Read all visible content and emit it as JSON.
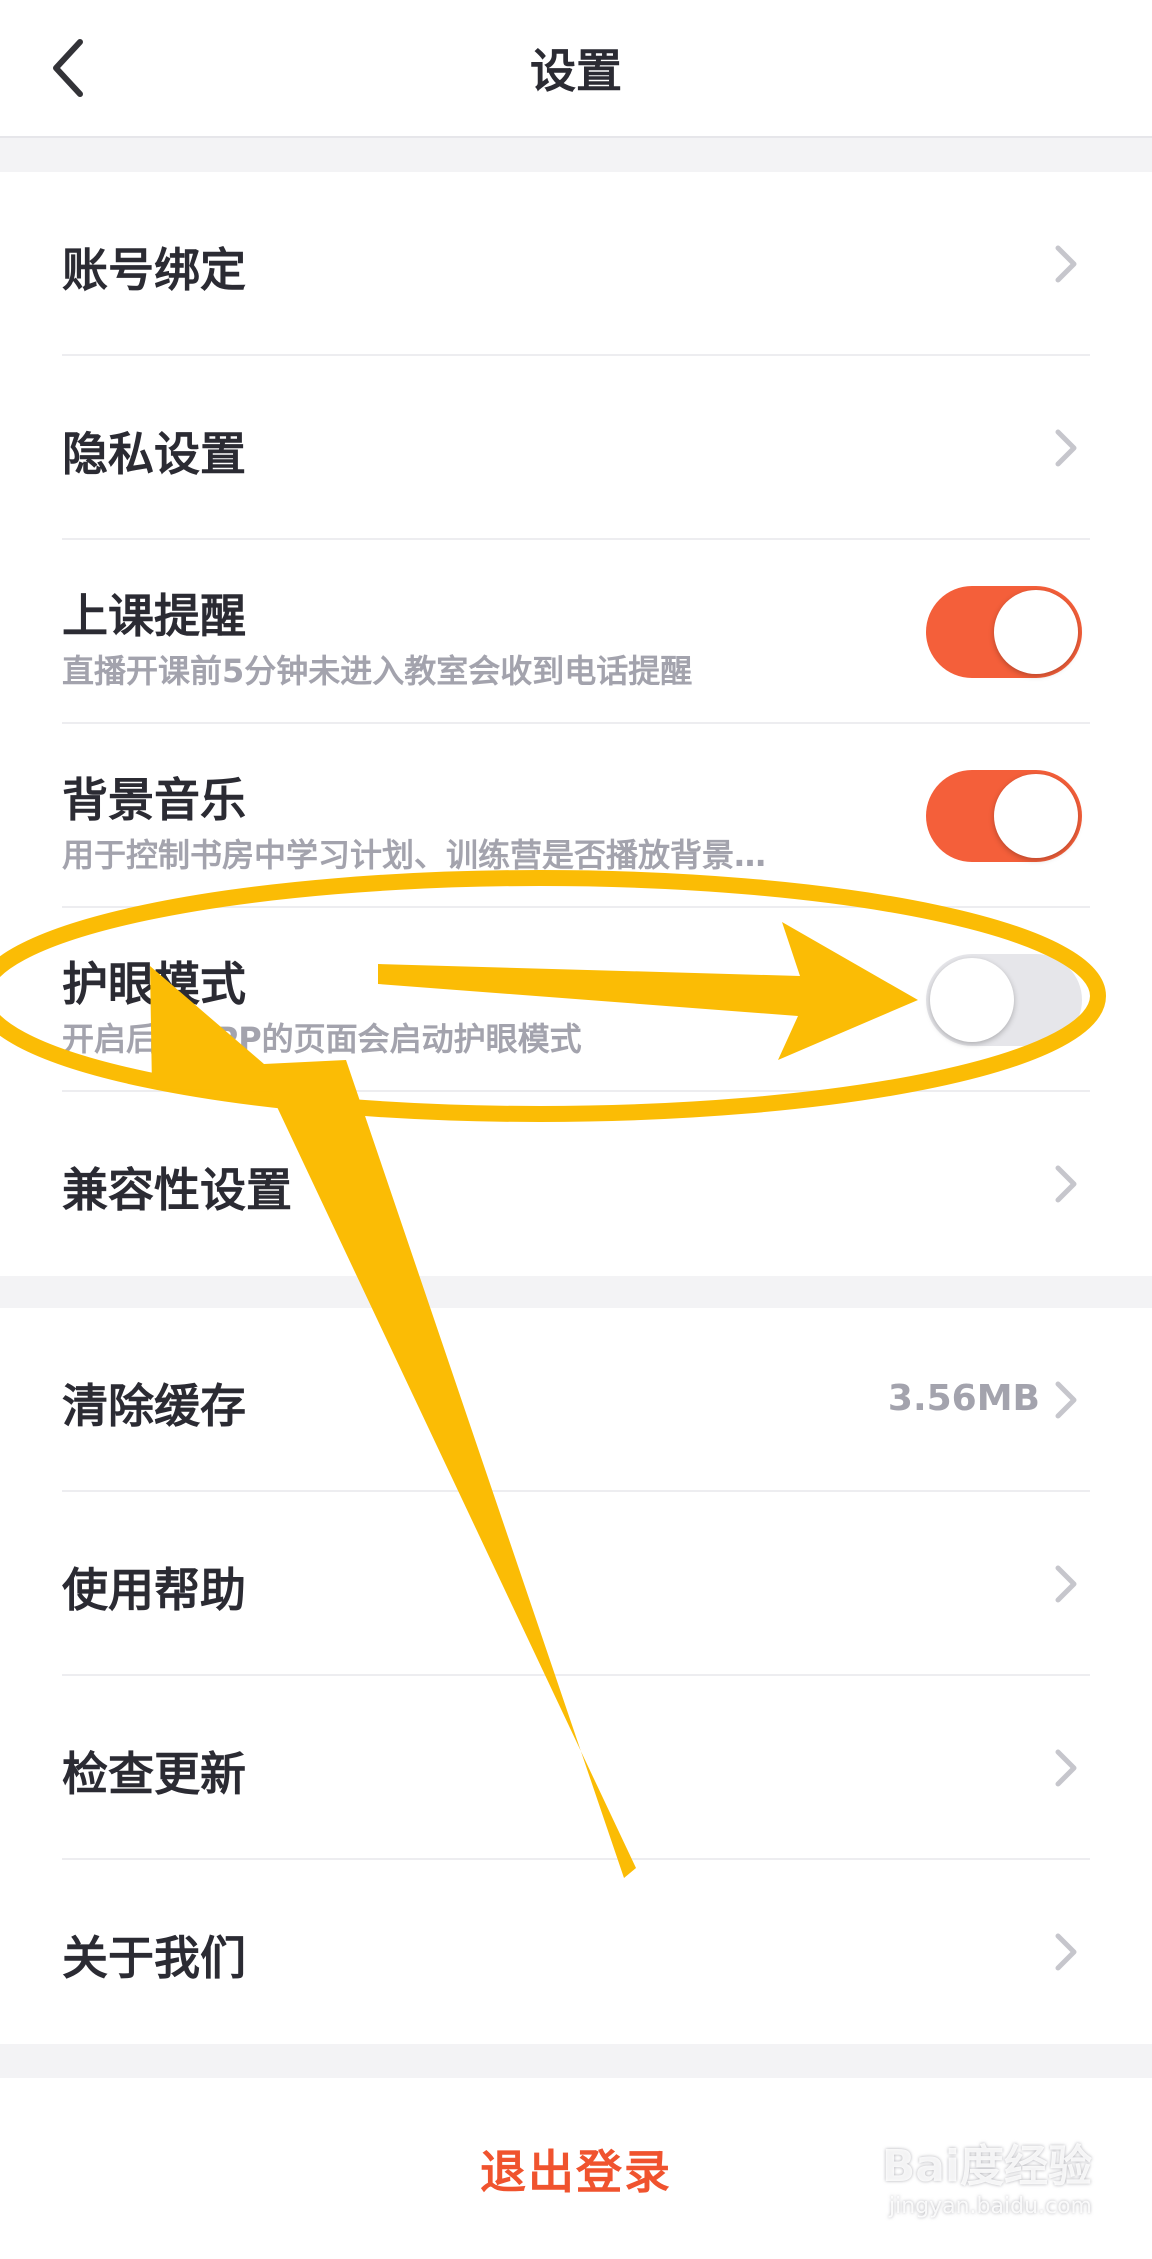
{
  "header": {
    "title": "设置",
    "back_icon": "chevron-left-icon"
  },
  "group1": [
    {
      "label": "账号绑定",
      "type": "link"
    },
    {
      "label": "隐私设置",
      "type": "link"
    },
    {
      "label": "上课提醒",
      "sub": "直播开课前5分钟未进入教室会收到电话提醒",
      "type": "toggle",
      "on": true
    },
    {
      "label": "背景音乐",
      "sub": "用于控制书房中学习计划、训练营是否播放背景…",
      "type": "toggle",
      "on": true
    },
    {
      "label": "护眼模式",
      "sub": "开启后，APP的页面会启动护眼模式",
      "type": "toggle",
      "on": false
    },
    {
      "label": "兼容性设置",
      "type": "link"
    }
  ],
  "group2": [
    {
      "label": "清除缓存",
      "value": "3.56MB",
      "type": "link"
    },
    {
      "label": "使用帮助",
      "type": "link"
    },
    {
      "label": "检查更新",
      "type": "link"
    },
    {
      "label": "关于我们",
      "type": "link"
    }
  ],
  "logout_label": "退出登录",
  "watermark": {
    "line1": "Bai度经验",
    "line2": "jingyan.baidu.com"
  },
  "colors": {
    "accent": "#f45f3a",
    "logout": "#f0532e",
    "annotation": "#fbbc05"
  }
}
